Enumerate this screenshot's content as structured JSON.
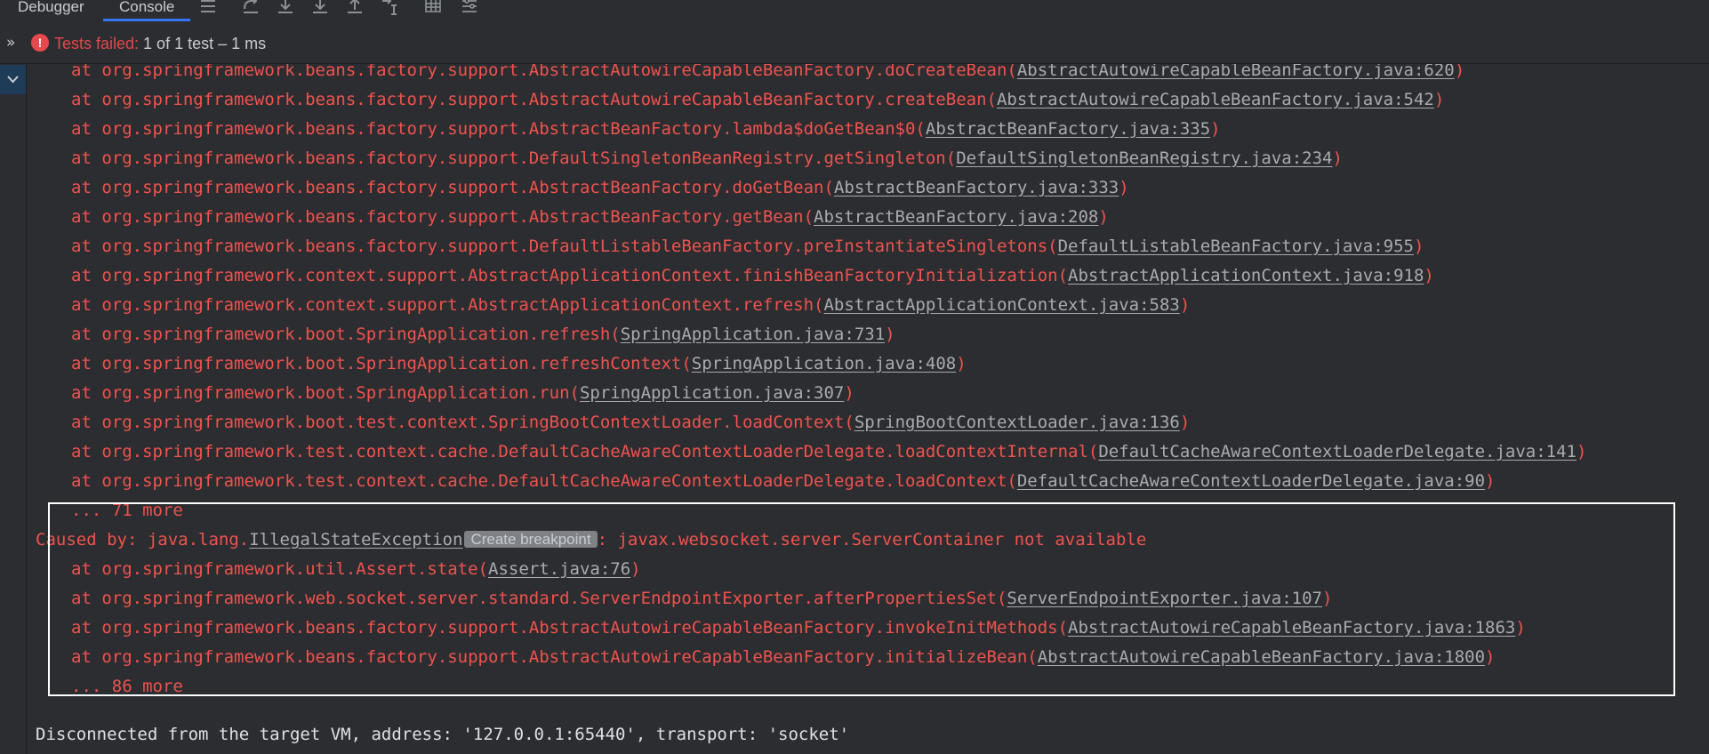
{
  "tabs": {
    "debugger": "Debugger",
    "console": "Console"
  },
  "status": {
    "label": "Tests failed:",
    "detail": " 1 of 1 test – 1 ms"
  },
  "stack_top": [
    {
      "prefix": "at org.springframework.beans.factory.support.AbstractAutowireCapableBeanFactory.doCreateBean(",
      "link": "AbstractAutowireCapableBeanFactory.java:620",
      "suffix": ")"
    },
    {
      "prefix": "at org.springframework.beans.factory.support.AbstractAutowireCapableBeanFactory.createBean(",
      "link": "AbstractAutowireCapableBeanFactory.java:542",
      "suffix": ")"
    },
    {
      "prefix": "at org.springframework.beans.factory.support.AbstractBeanFactory.lambda$doGetBean$0(",
      "link": "AbstractBeanFactory.java:335",
      "suffix": ")"
    },
    {
      "prefix": "at org.springframework.beans.factory.support.DefaultSingletonBeanRegistry.getSingleton(",
      "link": "DefaultSingletonBeanRegistry.java:234",
      "suffix": ")"
    },
    {
      "prefix": "at org.springframework.beans.factory.support.AbstractBeanFactory.doGetBean(",
      "link": "AbstractBeanFactory.java:333",
      "suffix": ")"
    },
    {
      "prefix": "at org.springframework.beans.factory.support.AbstractBeanFactory.getBean(",
      "link": "AbstractBeanFactory.java:208",
      "suffix": ")"
    },
    {
      "prefix": "at org.springframework.beans.factory.support.DefaultListableBeanFactory.preInstantiateSingletons(",
      "link": "DefaultListableBeanFactory.java:955",
      "suffix": ")"
    },
    {
      "prefix": "at org.springframework.context.support.AbstractApplicationContext.finishBeanFactoryInitialization(",
      "link": "AbstractApplicationContext.java:918",
      "suffix": ")"
    },
    {
      "prefix": "at org.springframework.context.support.AbstractApplicationContext.refresh(",
      "link": "AbstractApplicationContext.java:583",
      "suffix": ")"
    },
    {
      "prefix": "at org.springframework.boot.SpringApplication.refresh(",
      "link": "SpringApplication.java:731",
      "suffix": ")"
    },
    {
      "prefix": "at org.springframework.boot.SpringApplication.refreshContext(",
      "link": "SpringApplication.java:408",
      "suffix": ")"
    },
    {
      "prefix": "at org.springframework.boot.SpringApplication.run(",
      "link": "SpringApplication.java:307",
      "suffix": ")"
    },
    {
      "prefix": "at org.springframework.boot.test.context.SpringBootContextLoader.loadContext(",
      "link": "SpringBootContextLoader.java:136",
      "suffix": ")"
    },
    {
      "prefix": "at org.springframework.test.context.cache.DefaultCacheAwareContextLoaderDelegate.loadContextInternal(",
      "link": "DefaultCacheAwareContextLoaderDelegate.java:141",
      "suffix": ")"
    },
    {
      "prefix": "at org.springframework.test.context.cache.DefaultCacheAwareContextLoaderDelegate.loadContext(",
      "link": "DefaultCacheAwareContextLoaderDelegate.java:90",
      "suffix": ")"
    }
  ],
  "more_71": "... 71 more",
  "caused_by": {
    "prefix": "Caused by: java.lang.",
    "exception": "IllegalStateException",
    "breakpoint": "Create breakpoint",
    "message": ": javax.websocket.server.ServerContainer not available"
  },
  "stack_bottom": [
    {
      "prefix": "at org.springframework.util.Assert.state(",
      "link": "Assert.java:76",
      "suffix": ")"
    },
    {
      "prefix": "at org.springframework.web.socket.server.standard.ServerEndpointExporter.afterPropertiesSet(",
      "link": "ServerEndpointExporter.java:107",
      "suffix": ")"
    },
    {
      "prefix": "at org.springframework.beans.factory.support.AbstractAutowireCapableBeanFactory.invokeInitMethods(",
      "link": "AbstractAutowireCapableBeanFactory.java:1863",
      "suffix": ")"
    },
    {
      "prefix": "at org.springframework.beans.factory.support.AbstractAutowireCapableBeanFactory.initializeBean(",
      "link": "AbstractAutowireCapableBeanFactory.java:1800",
      "suffix": ")"
    }
  ],
  "more_86": "... 86 more",
  "disconnected": "Disconnected from the target VM, address: '127.0.0.1:65440', transport: 'socket'",
  "icons": {
    "fail": "error-icon",
    "expand": "double-chevron-right-icon",
    "collapse": "chevron-down-icon",
    "toolbar": [
      "menu-icon",
      "step-over-icon",
      "step-into-icon",
      "force-step-into-icon",
      "step-out-icon",
      "run-to-cursor-icon",
      "evaluate-table-icon",
      "settings-icon"
    ]
  }
}
